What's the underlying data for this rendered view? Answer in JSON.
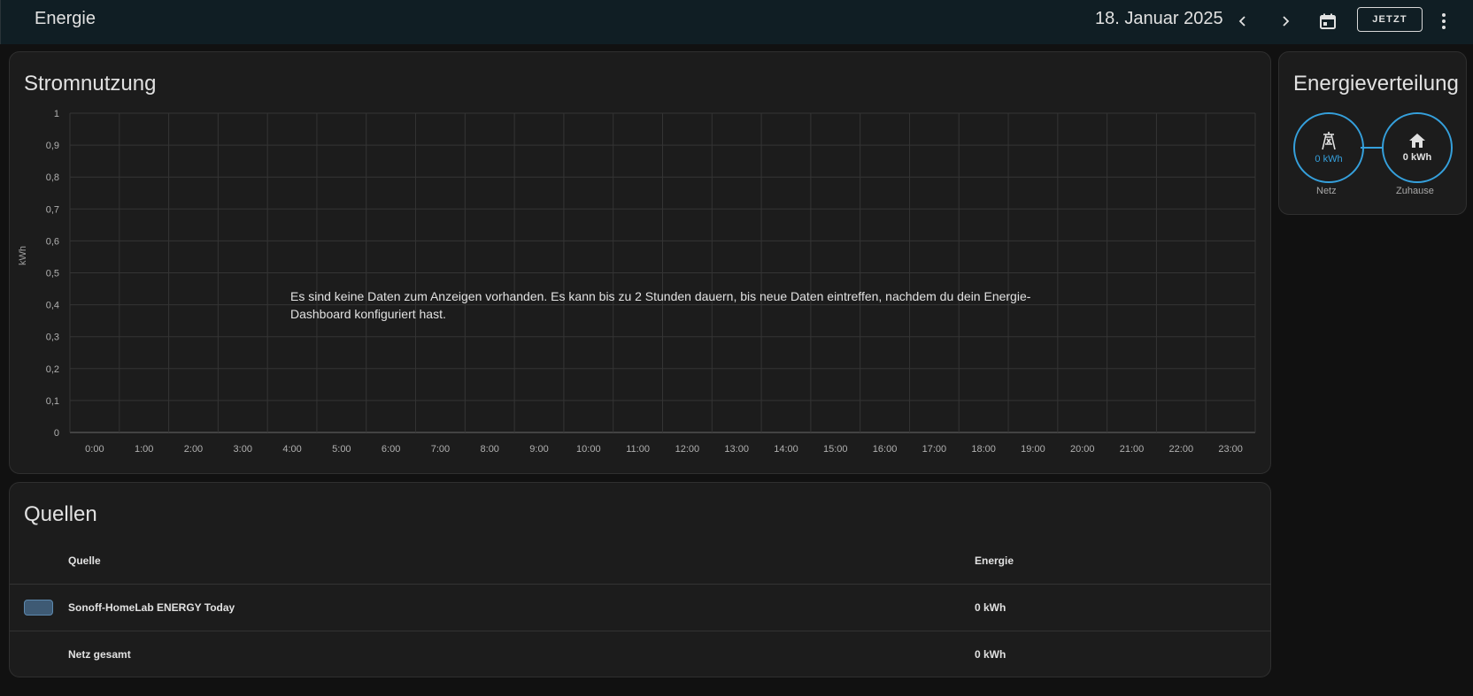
{
  "header": {
    "title": "Energie",
    "date": "18. Januar 2025",
    "now_label": "JETZT"
  },
  "usage_card": {
    "title": "Stromnutzung",
    "no_data": "Es sind keine Daten zum Anzeigen vorhanden. Es kann bis zu 2 Stunden dauern, bis neue Daten eintreffen, nachdem du dein Energie-Dashboard konfiguriert hast."
  },
  "chart_data": {
    "type": "bar",
    "title": "Stromnutzung",
    "xlabel": "",
    "ylabel": "kWh",
    "ylim": [
      0,
      1
    ],
    "y_ticks": [
      "0",
      "0,1",
      "0,2",
      "0,3",
      "0,4",
      "0,5",
      "0,6",
      "0,7",
      "0,8",
      "0,9",
      "1"
    ],
    "categories": [
      "0:00",
      "1:00",
      "2:00",
      "3:00",
      "4:00",
      "5:00",
      "6:00",
      "7:00",
      "8:00",
      "9:00",
      "10:00",
      "11:00",
      "12:00",
      "13:00",
      "14:00",
      "15:00",
      "16:00",
      "17:00",
      "18:00",
      "19:00",
      "20:00",
      "21:00",
      "22:00",
      "23:00"
    ],
    "series": [],
    "grid": true
  },
  "sources_card": {
    "title": "Quellen",
    "col_source": "Quelle",
    "col_energy": "Energie",
    "rows": [
      {
        "name": "Sonoff-HomeLab ENERGY Today",
        "value": "0 kWh",
        "color": "#3e5a74"
      }
    ],
    "total": {
      "name": "Netz gesamt",
      "value": "0 kWh"
    }
  },
  "distribution_card": {
    "title": "Energieverteilung",
    "grid": {
      "value": "0 kWh",
      "label": "Netz",
      "icon": "transmission-tower-icon",
      "color": "#35a0dc"
    },
    "home": {
      "value": "0 kWh",
      "label": "Zuhause",
      "icon": "home-icon"
    }
  }
}
